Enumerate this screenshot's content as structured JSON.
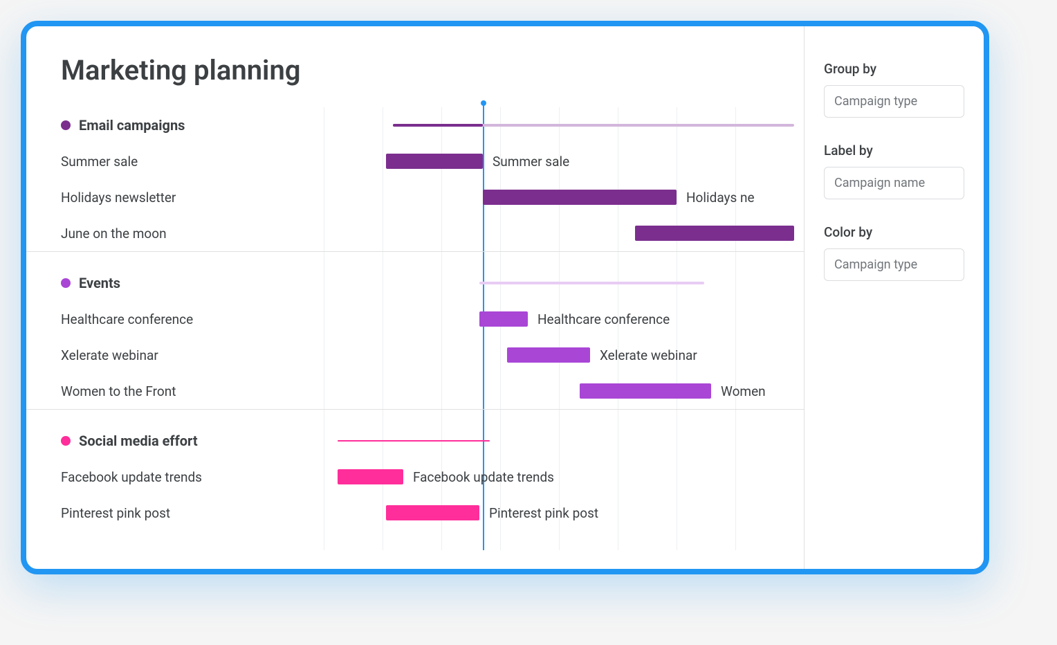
{
  "title": "Marketing planning",
  "panel": {
    "group_by_label": "Group by",
    "group_by_value": "Campaign type",
    "label_by_label": "Label by",
    "label_by_value": "Campaign name",
    "color_by_label": "Color by",
    "color_by_value": "Campaign type"
  },
  "chart_data": {
    "type": "bar",
    "title": "Marketing planning",
    "xlabel": "",
    "ylabel": "",
    "x_range": [
      0,
      680
    ],
    "today_marker_x": 230,
    "gridlines_x": [
      0,
      85,
      170,
      255,
      340,
      425,
      510,
      595
    ],
    "series": [
      {
        "name": "Email campaigns",
        "color": "#7b2e8e",
        "span": {
          "x0": 100,
          "x1": 680,
          "accent_x": 230,
          "light_color": "#d3b6dc"
        },
        "items": [
          {
            "label": "Summer sale",
            "x0": 90,
            "x1": 230,
            "bar_label": "Summer sale"
          },
          {
            "label": "Holidays newsletter",
            "x0": 230,
            "x1": 510,
            "bar_label": "Holidays ne"
          },
          {
            "label": "June on the moon",
            "x0": 450,
            "x1": 680,
            "bar_label": ""
          }
        ]
      },
      {
        "name": "Events",
        "color": "#a946d6",
        "span": {
          "x0": 225,
          "x1": 550,
          "light_color": "#e8ccf4"
        },
        "items": [
          {
            "label": "Healthcare conference",
            "x0": 225,
            "x1": 295,
            "bar_label": "Healthcare conference"
          },
          {
            "label": "Xelerate webinar",
            "x0": 265,
            "x1": 385,
            "bar_label": "Xelerate webinar"
          },
          {
            "label": "Women to the Front",
            "x0": 370,
            "x1": 560,
            "bar_label": "Women"
          }
        ]
      },
      {
        "name": "Social media effort",
        "color": "#ff2e9a",
        "span": {
          "x0": 20,
          "x1": 240,
          "light_color": "#ff2e9a",
          "thin": true
        },
        "items": [
          {
            "label": "Facebook update trends",
            "x0": 20,
            "x1": 115,
            "bar_label": "Facebook update trends"
          },
          {
            "label": "Pinterest pink post",
            "x0": 90,
            "x1": 225,
            "bar_label": "Pinterest pink post"
          }
        ]
      }
    ]
  }
}
